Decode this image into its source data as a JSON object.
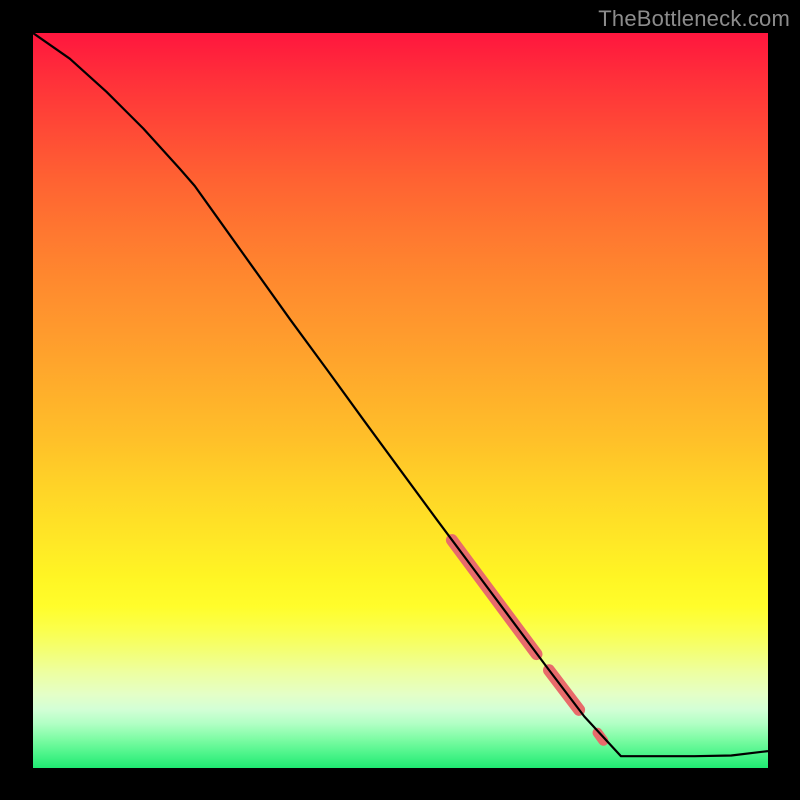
{
  "watermark": "TheBottleneck.com",
  "chart_data": {
    "type": "line",
    "title": "",
    "xlabel": "",
    "ylabel": "",
    "xlim": [
      0,
      100
    ],
    "ylim": [
      0,
      100
    ],
    "grid": false,
    "series": [
      {
        "name": "curve",
        "color": "#000000",
        "x": [
          0,
          5,
          10,
          15,
          20,
          22,
          25,
          30,
          35,
          40,
          45,
          50,
          55,
          60,
          65,
          70,
          75,
          80,
          85,
          88,
          90,
          95,
          100
        ],
        "y": [
          100,
          96.5,
          92.0,
          87.0,
          81.5,
          79.2,
          75.0,
          68.0,
          61.0,
          54.2,
          47.3,
          40.5,
          33.7,
          27.0,
          20.3,
          13.6,
          7.0,
          1.6,
          1.6,
          1.6,
          1.6,
          1.7,
          2.3
        ]
      }
    ],
    "highlight_segments": [
      {
        "x0": 57,
        "y0": 31,
        "x1": 68.5,
        "y1": 15.5,
        "width": 12
      },
      {
        "x0": 70.2,
        "y0": 13.3,
        "x1": 74.3,
        "y1": 7.9,
        "width": 12
      },
      {
        "x0": 76.8,
        "y0": 4.8,
        "x1": 77.6,
        "y1": 3.7,
        "width": 10
      }
    ],
    "colors": {
      "highlight": "#e86b6b",
      "line": "#000000"
    }
  }
}
